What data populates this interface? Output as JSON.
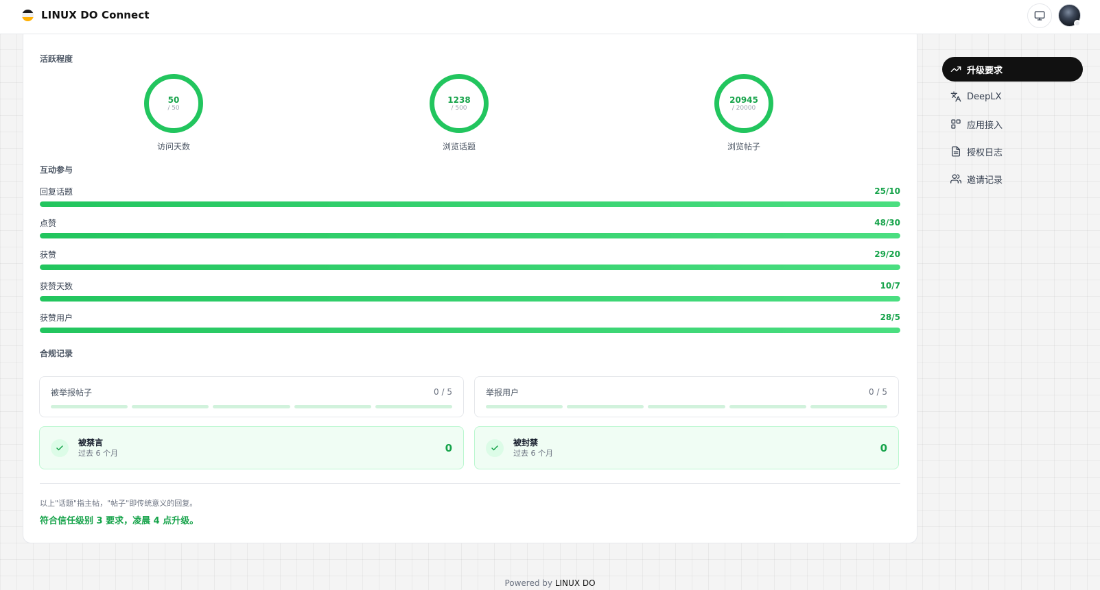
{
  "header": {
    "brand": "LINUX DO Connect",
    "monitor_icon": "monitor-icon",
    "avatar_icon": "user-avatar"
  },
  "activity": {
    "title": "活跃程度",
    "rings": [
      {
        "value": "50",
        "target": "/ 50",
        "label": "访问天数",
        "progress": 1.0
      },
      {
        "value": "1238",
        "target": "/ 500",
        "label": "浏览话题",
        "progress": 1.0
      },
      {
        "value": "20945",
        "target": "/ 20000",
        "label": "浏览帖子",
        "progress": 1.0
      }
    ]
  },
  "engagement": {
    "title": "互动参与",
    "bars": [
      {
        "label": "回复话题",
        "value": "25/10",
        "progress": 1.0
      },
      {
        "label": "点赞",
        "value": "48/30",
        "progress": 1.0
      },
      {
        "label": "获赞",
        "value": "29/20",
        "progress": 1.0
      },
      {
        "label": "获赞天数",
        "value": "10/7",
        "progress": 1.0
      },
      {
        "label": "获赞用户",
        "value": "28/5",
        "progress": 1.0
      }
    ]
  },
  "compliance": {
    "title": "合规记录",
    "reports": [
      {
        "label": "被举报帖子",
        "count": "0 / 5"
      },
      {
        "label": "举报用户",
        "count": "0 / 5"
      }
    ],
    "statuses": [
      {
        "title": "被禁言",
        "sub": "过去 6 个月",
        "count": "0"
      },
      {
        "title": "被封禁",
        "sub": "过去 6 个月",
        "count": "0"
      }
    ]
  },
  "note": "以上\"话题\"指主帖，\"帖子\"即传统意义的回复。",
  "upgrade_message": "符合信任级别 3 要求，凌晨 4 点升级。",
  "sidebar": {
    "items": [
      {
        "label": "升级要求",
        "icon": "trending-up-icon",
        "active": true
      },
      {
        "label": "DeepLX",
        "icon": "translate-icon",
        "active": false
      },
      {
        "label": "应用接入",
        "icon": "apps-icon",
        "active": false
      },
      {
        "label": "授权日志",
        "icon": "document-icon",
        "active": false
      },
      {
        "label": "邀请记录",
        "icon": "users-icon",
        "active": false
      }
    ]
  },
  "footer": {
    "prefix": "Powered by",
    "brand": "LINUX DO"
  },
  "colors": {
    "accent": "#22c55e",
    "accent_dark": "#16a34a",
    "active_nav": "#111111"
  }
}
